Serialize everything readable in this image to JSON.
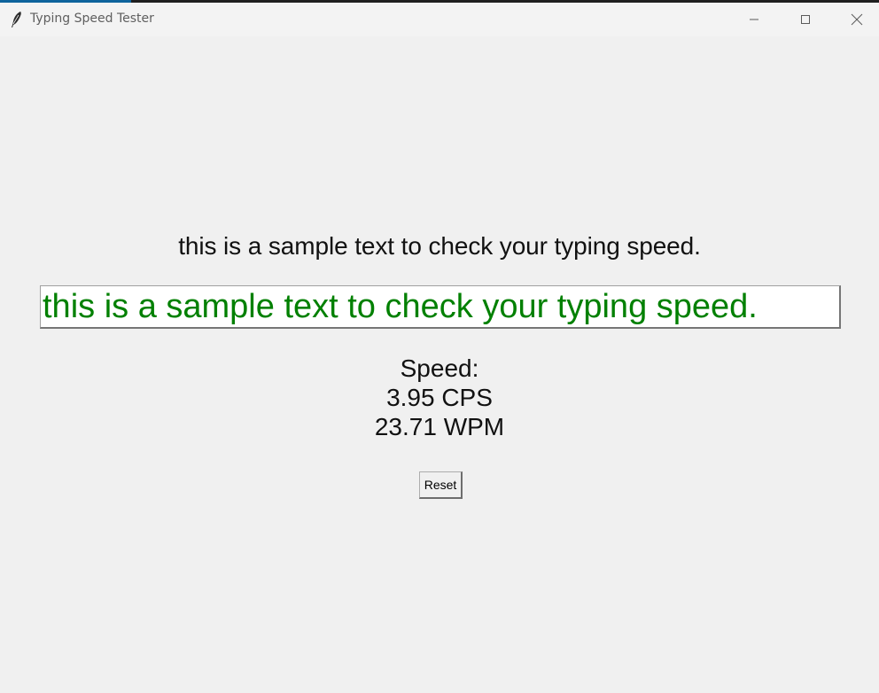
{
  "window": {
    "title": "Typing Speed Tester",
    "icons": {
      "app": "feather-icon",
      "minimize": "minimize-icon",
      "maximize": "maximize-icon",
      "close": "close-icon"
    }
  },
  "main": {
    "sample_text": "this is a sample text to check your typing speed.",
    "typed_text": "this is a sample text to check your typing speed.",
    "typed_color": "#008000",
    "speed_heading": "Speed:",
    "cps": "3.95 CPS",
    "wpm": "23.71 WPM",
    "reset_label": "Reset"
  }
}
